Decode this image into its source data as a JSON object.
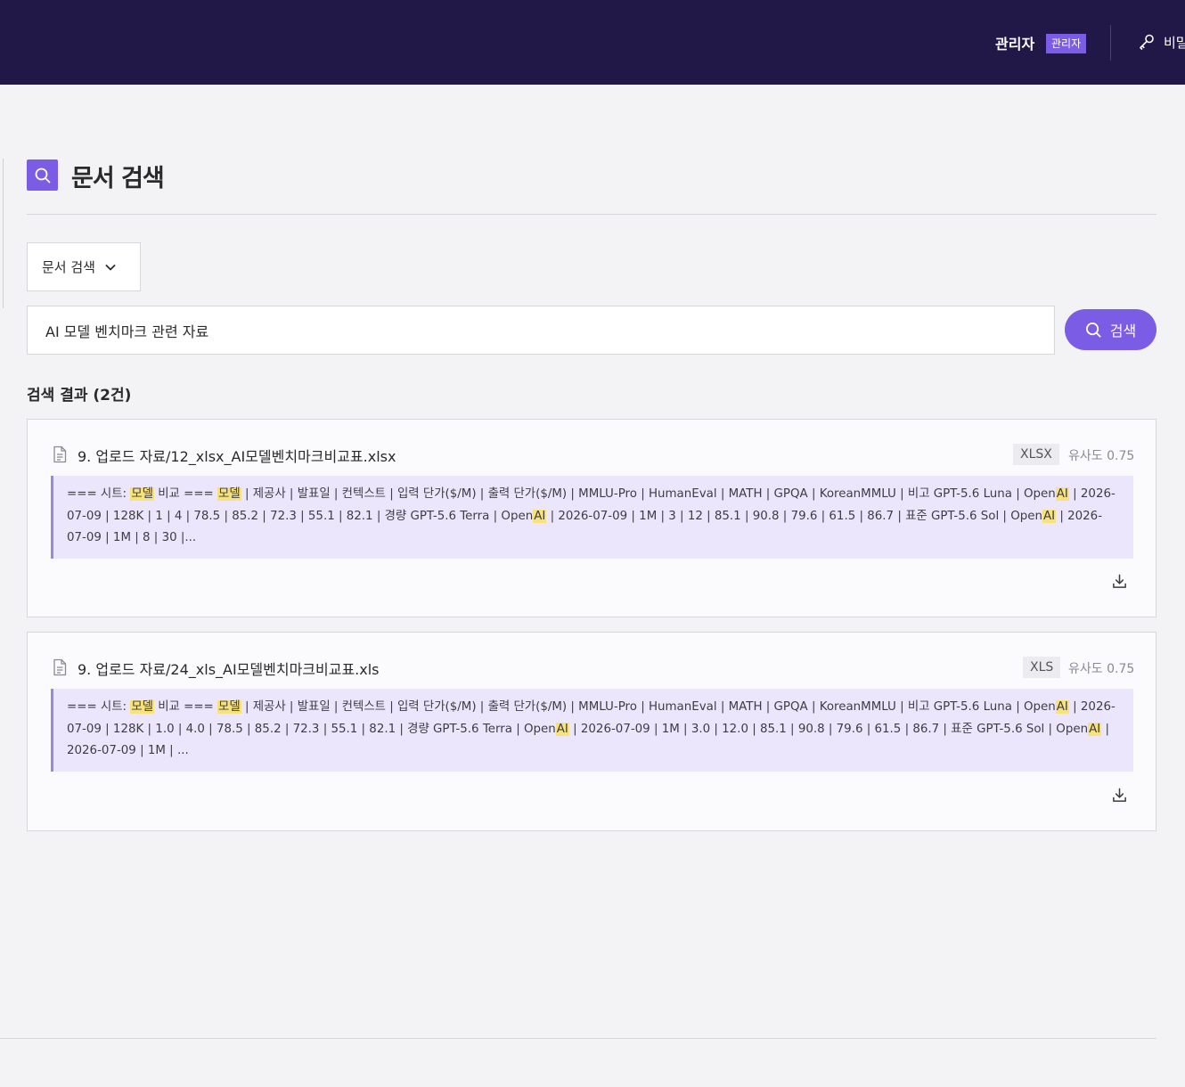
{
  "header": {
    "user_name": "관리자",
    "role_badge": "관리자",
    "key_link_label": "비밀"
  },
  "page": {
    "title": "문서 검색",
    "mode_select_value": "문서 검색"
  },
  "search": {
    "query": "AI 모델 벤치마크 관련 자료",
    "button_label": "검색"
  },
  "results": {
    "heading": "검색 결과 (2건)",
    "items": [
      {
        "path": "9. 업로드 자료/12_xlsx_AI모델벤치마크비교표.xlsx",
        "type": "XLSX",
        "similarity": "유사도 0.75",
        "snippet": [
          {
            "t": "=== 시트: "
          },
          {
            "t": "모델",
            "hl": true
          },
          {
            "t": " 비교 === "
          },
          {
            "t": "모델",
            "hl": true
          },
          {
            "t": " | 제공사 | 발표일 | 컨텍스트 | 입력 단가($/M) | 출력 단가($/M) | MMLU-Pro | HumanEval | MATH | GPQA | KoreanMMLU | 비고 GPT-5.6 Luna | Open"
          },
          {
            "t": "AI",
            "hl": true
          },
          {
            "t": " | 2026-07-09 | 128K | 1 | 4 | 78.5 | 85.2 | 72.3 | 55.1 | 82.1 | 경량 GPT-5.6 Terra | Open"
          },
          {
            "t": "AI",
            "hl": true
          },
          {
            "t": " | 2026-07-09 | 1M | 3 | 12 | 85.1 | 90.8 | 79.6 | 61.5 | 86.7 | 표준 GPT-5.6 Sol | Open"
          },
          {
            "t": "AI",
            "hl": true
          },
          {
            "t": " | 2026-07-09 | 1M | 8 | 30 |..."
          }
        ]
      },
      {
        "path": "9. 업로드 자료/24_xls_AI모델벤치마크비교표.xls",
        "type": "XLS",
        "similarity": "유사도 0.75",
        "snippet": [
          {
            "t": "=== 시트: "
          },
          {
            "t": "모델",
            "hl": true
          },
          {
            "t": " 비교 === "
          },
          {
            "t": "모델",
            "hl": true
          },
          {
            "t": " | 제공사 | 발표일 | 컨텍스트 | 입력 단가($/M) | 출력 단가($/M) | MMLU-Pro | HumanEval | MATH | GPQA | KoreanMMLU | 비고 GPT-5.6 Luna | Open"
          },
          {
            "t": "AI",
            "hl": true
          },
          {
            "t": " | 2026-07-09 | 128K | 1.0 | 4.0 | 78.5 | 85.2 | 72.3 | 55.1 | 82.1 | 경량 GPT-5.6 Terra | Open"
          },
          {
            "t": "AI",
            "hl": true
          },
          {
            "t": " | 2026-07-09 | 1M | 3.0 | 12.0 | 85.1 | 90.8 | 79.6 | 61.5 | 86.7 | 표준 GPT-5.6 Sol | Open"
          },
          {
            "t": "AI",
            "hl": true
          },
          {
            "t": " | 2026-07-09 | 1M | ..."
          }
        ]
      }
    ]
  },
  "icons": {
    "key": "key-icon",
    "search": "search-icon",
    "chevron": "chevron-down-icon",
    "file": "file-icon",
    "download": "download-icon"
  },
  "colors": {
    "topbar": "#211848",
    "accent": "#7b5ce5",
    "snippet_bg": "#ebe6fc",
    "highlight": "#f7e27c"
  }
}
